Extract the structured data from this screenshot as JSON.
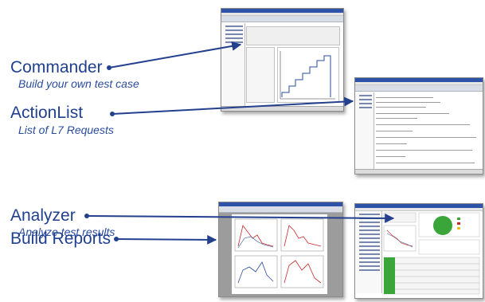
{
  "items": [
    {
      "title": "Commander",
      "subtitle": "Build your own test case"
    },
    {
      "title": "ActionList",
      "subtitle": "List of L7 Requests"
    },
    {
      "title": "Analyzer",
      "subtitle": "Analyze test results"
    },
    {
      "title": "Build Reports",
      "subtitle": ""
    }
  ],
  "colors": {
    "label": "#1f3f8f",
    "arrow": "#23408e",
    "chart_green": "#3aa63a",
    "chart_red": "#cc2a2a",
    "window_blue": "#2d52a8"
  }
}
